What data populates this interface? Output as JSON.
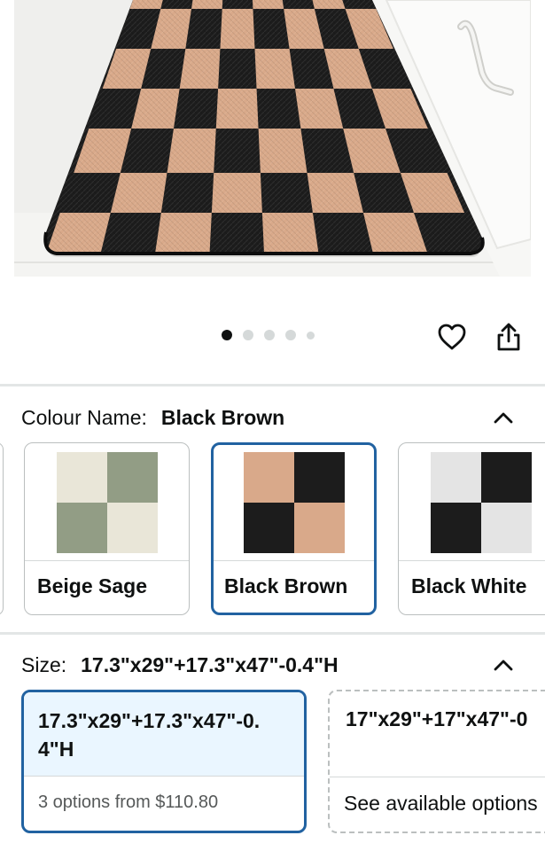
{
  "product_image": {
    "alt": "Checkered kitchen mat"
  },
  "carousel": {
    "total_dots": 5,
    "active_index": 0
  },
  "actions": {
    "wishlist_icon": "heart-icon",
    "share_icon": "share-icon"
  },
  "colour": {
    "label": "Colour Name:",
    "selected": "Black Brown",
    "swatches": [
      {
        "name": "Beige Sage",
        "colors": [
          "#e9e6d8",
          "#929d85"
        ]
      },
      {
        "name": "Black Brown",
        "colors": [
          "#d9a98a",
          "#1c1c1c"
        ]
      },
      {
        "name": "Black White",
        "colors": [
          "#e4e4e4",
          "#1c1c1c"
        ]
      }
    ]
  },
  "size": {
    "label": "Size:",
    "selected": "17.3\"x29\"+17.3\"x47\"-0.4\"H",
    "options": [
      {
        "line1": "17.3\"x29\"+17.3\"x47\"-0.",
        "line2": "4\"H",
        "sub": "3 options from $110.80"
      },
      {
        "line1": "17\"x29\"+17\"x47\"-0",
        "sub": "See available options"
      }
    ]
  },
  "colors": {
    "selected_border": "#2162a1",
    "selected_bg": "#eaf6ff",
    "divider": "#e3e6e6"
  }
}
